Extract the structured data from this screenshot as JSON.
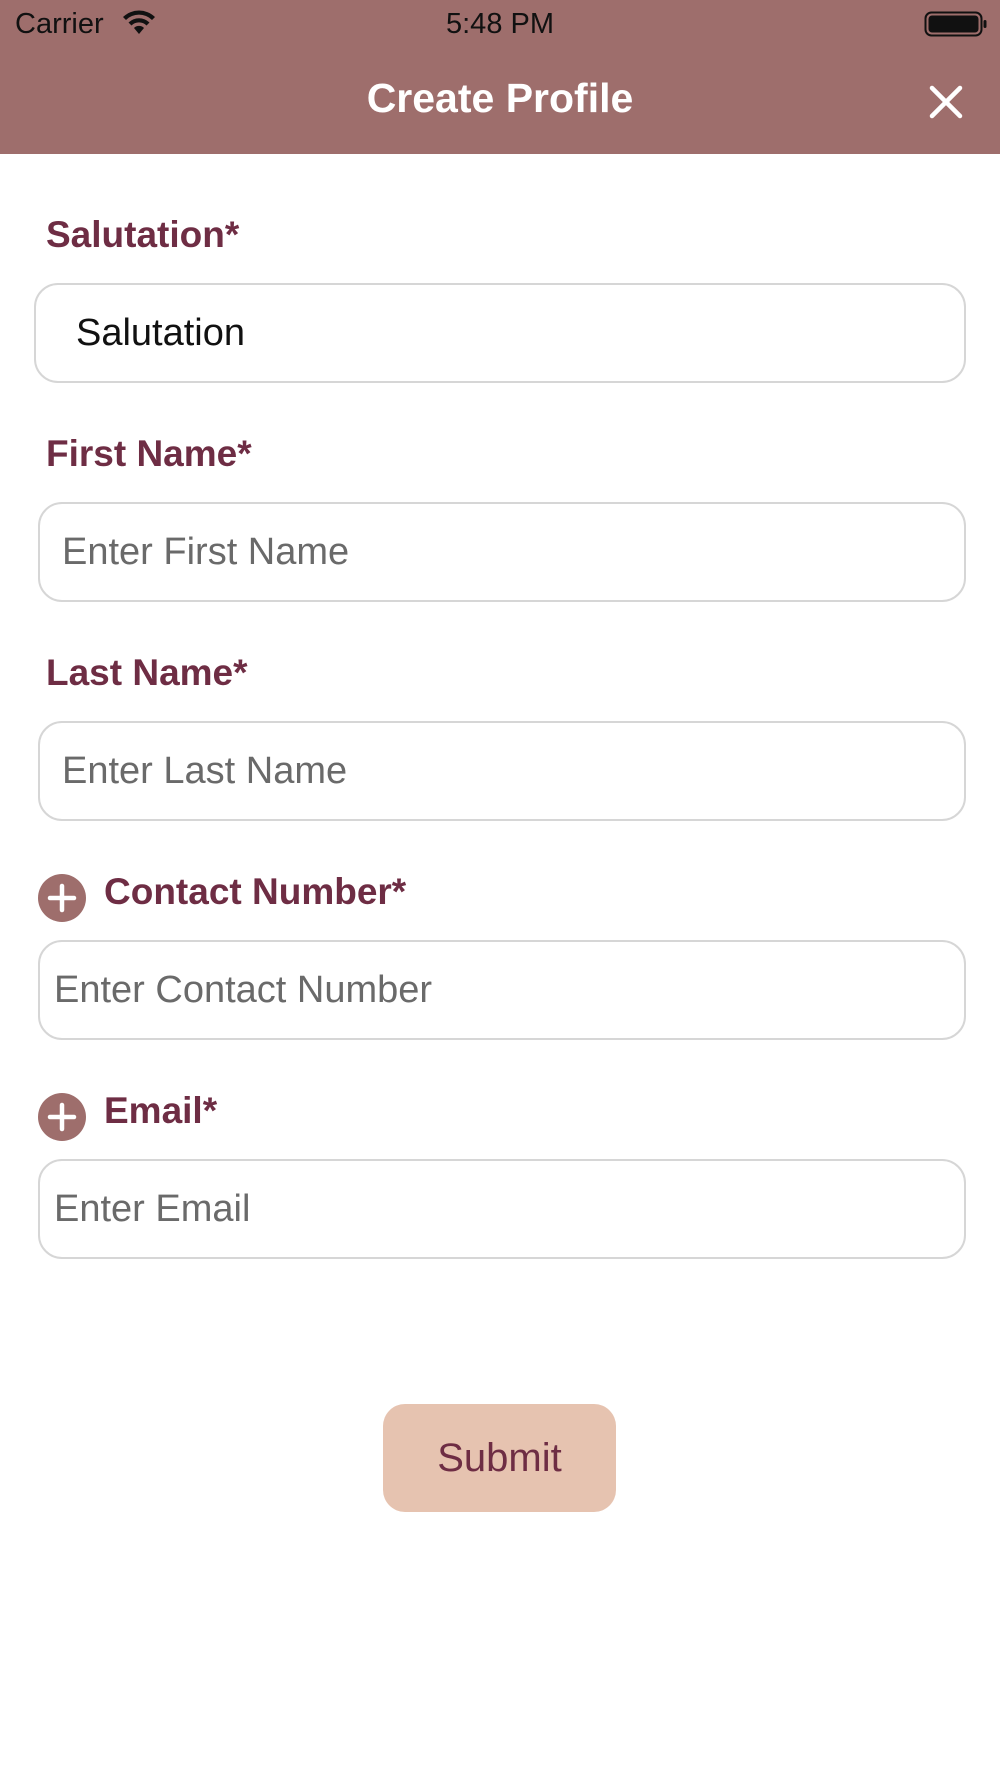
{
  "status_bar": {
    "carrier": "Carrier",
    "time": "5:48 PM",
    "wifi_icon": "wifi-icon",
    "battery_icon": "battery-full-icon"
  },
  "header": {
    "title": "Create Profile",
    "close_icon": "close-icon",
    "background_color": "#9e6e6c"
  },
  "form": {
    "salutation": {
      "label": "Salutation*",
      "value": "Salutation"
    },
    "first_name": {
      "label": "First Name*",
      "placeholder": "Enter First Name",
      "value": ""
    },
    "last_name": {
      "label": "Last Name*",
      "placeholder": "Enter Last Name",
      "value": ""
    },
    "contact_number": {
      "label": "Contact Number*",
      "placeholder": "Enter Contact Number",
      "value": "",
      "add_icon": "plus-circle-icon"
    },
    "email": {
      "label": "Email*",
      "placeholder": "Enter Email",
      "value": "",
      "add_icon": "plus-circle-icon"
    },
    "label_color": "#6e2d44"
  },
  "submit": {
    "label": "Submit",
    "background_color": "#e6c3b0",
    "text_color": "#6e2d44"
  }
}
